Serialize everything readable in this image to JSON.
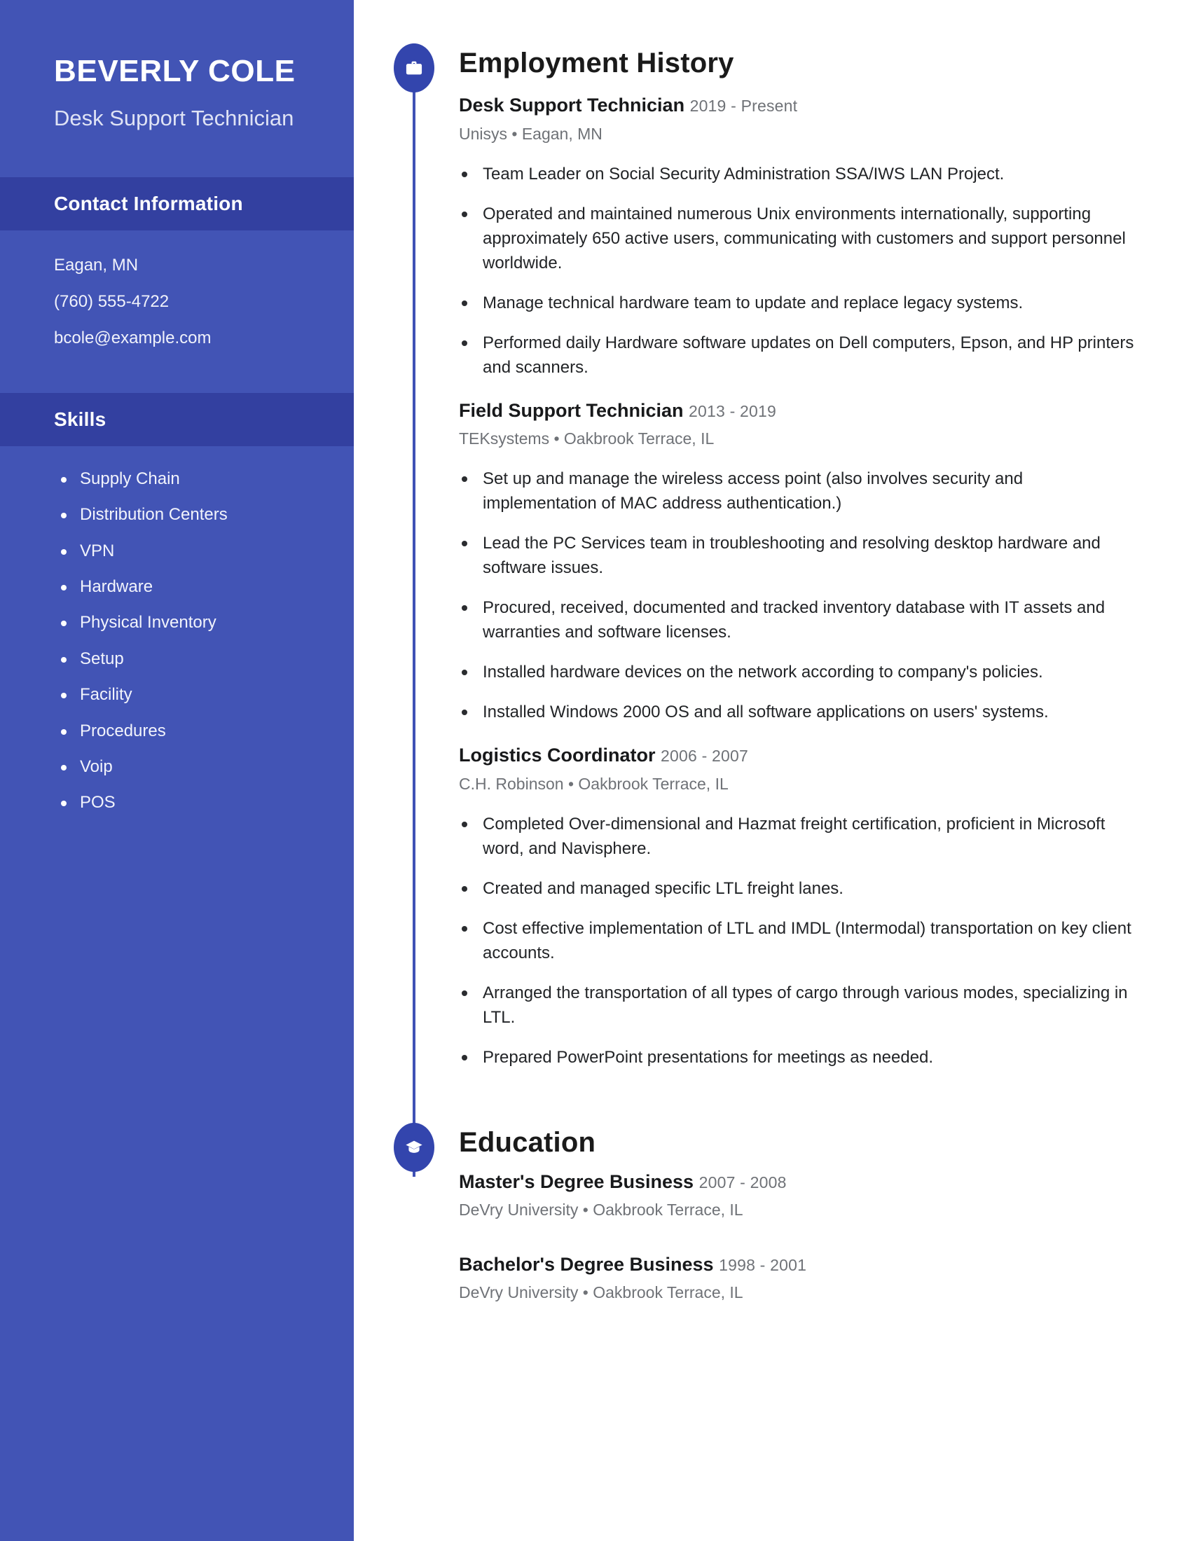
{
  "sidebar": {
    "name": "BEVERLY COLE",
    "title": "Desk Support Technician",
    "contact_heading": "Contact Information",
    "contact": [
      "Eagan, MN",
      "(760) 555-4722",
      "bcole@example.com"
    ],
    "skills_heading": "Skills",
    "skills": [
      "Supply Chain",
      "Distribution Centers",
      "VPN",
      "Hardware",
      "Physical Inventory",
      "Setup",
      "Facility",
      "Procedures",
      "Voip",
      "POS"
    ],
    "bg_color": "#4254b5",
    "header_bg_color": "#3340a0"
  },
  "main": {
    "employment": {
      "heading": "Employment History",
      "icon": "briefcase-icon",
      "jobs": [
        {
          "title": "Desk Support Technician",
          "dates": "2019 - Present",
          "subtitle": "Unisys  •  Eagan, MN",
          "bullets": [
            "Team Leader on Social Security Administration SSA/IWS LAN Project.",
            "Operated and maintained numerous Unix environments internationally, supporting approximately 650 active users, communicating with customers and support personnel worldwide.",
            "Manage technical hardware team to update and replace legacy systems.",
            "Performed daily Hardware software updates on Dell computers, Epson, and HP printers and scanners."
          ]
        },
        {
          "title": "Field Support Technician",
          "dates": "2013 - 2019",
          "subtitle": "TEKsystems  •  Oakbrook Terrace, IL",
          "bullets": [
            "Set up and manage the wireless access point (also involves security and implementation of MAC address authentication.)",
            "Lead the PC Services team in troubleshooting and resolving desktop hardware and software issues.",
            "Procured, received, documented and tracked inventory database with IT assets and warranties and software licenses.",
            "Installed hardware devices on the network according to company's policies.",
            "Installed Windows 2000 OS and all software applications on users' systems."
          ]
        },
        {
          "title": "Logistics Coordinator",
          "dates": "2006 - 2007",
          "subtitle": "C.H. Robinson  •  Oakbrook Terrace, IL",
          "bullets": [
            "Completed Over-dimensional and Hazmat freight certification, proficient in Microsoft word, and Navisphere.",
            "Created and managed specific LTL freight lanes.",
            "Cost effective implementation of LTL and IMDL (Intermodal) transportation on key client accounts.",
            "Arranged the transportation of all types of cargo through various modes, specializing in LTL.",
            "Prepared PowerPoint presentations for meetings as needed."
          ]
        }
      ]
    },
    "education": {
      "heading": "Education",
      "icon": "graduation-cap-icon",
      "entries": [
        {
          "degree": "Master's Degree Business",
          "dates": "2007 - 2008",
          "subtitle": "DeVry University  •  Oakbrook Terrace, IL"
        },
        {
          "degree": "Bachelor's Degree Business",
          "dates": "1998 - 2001",
          "subtitle": "DeVry University  •  Oakbrook Terrace, IL"
        }
      ]
    },
    "accent_color": "#3f51b5"
  }
}
